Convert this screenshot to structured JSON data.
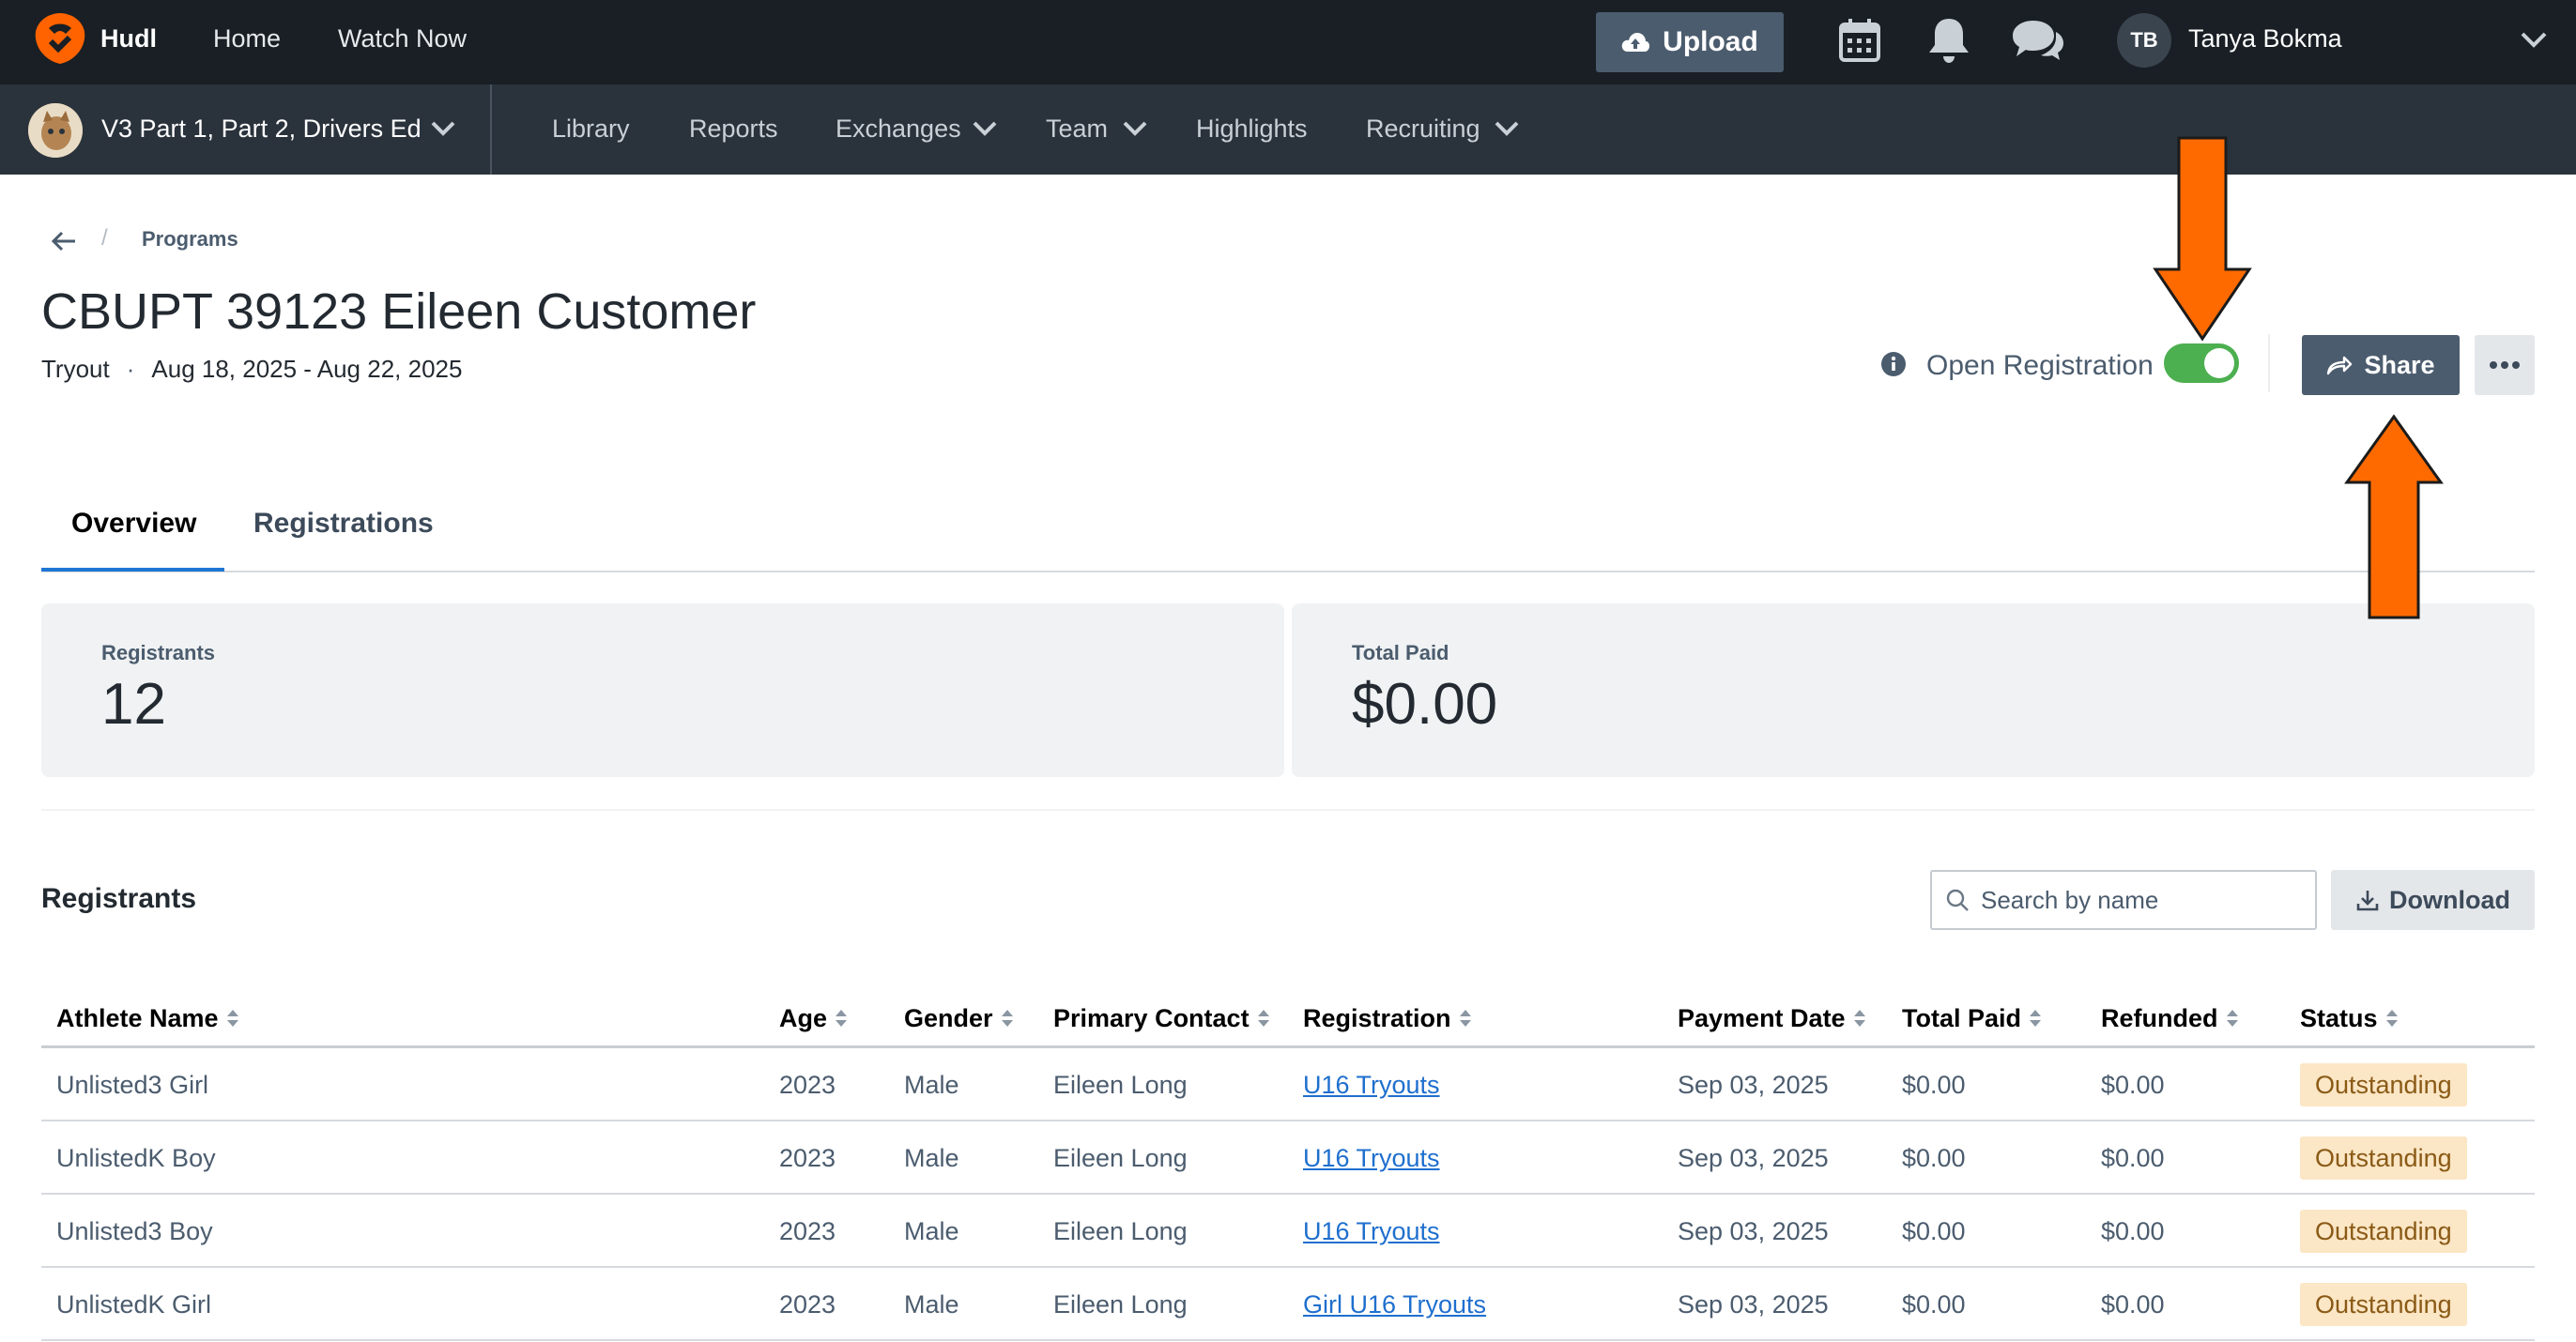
{
  "topbar": {
    "brand": "Hudl",
    "nav": [
      "Home",
      "Watch Now"
    ],
    "upload_label": "Upload",
    "icons": [
      "calendar-icon",
      "bell-icon",
      "chat-icon"
    ],
    "user_initials": "TB",
    "user_name": "Tanya Bokma"
  },
  "subbar": {
    "team_name": "V3 Part 1, Part 2, Drivers Ed",
    "nav": [
      "Library",
      "Reports",
      "Exchanges",
      "Team",
      "Highlights",
      "Recruiting"
    ]
  },
  "breadcrumb": {
    "current": "Programs",
    "separator": "/"
  },
  "program": {
    "title": "CBUPT 39123 Eileen Customer",
    "type": "Tryout",
    "separator": "·",
    "dates": "Aug 18, 2025 - Aug 22, 2025",
    "open_registration_label": "Open Registration",
    "open_registration_on": true,
    "share_label": "Share"
  },
  "tabs": [
    {
      "label": "Overview",
      "active": true
    },
    {
      "label": "Registrations",
      "active": false
    }
  ],
  "stats": {
    "registrants_label": "Registrants",
    "registrants_value": "12",
    "total_paid_label": "Total Paid",
    "total_paid_value": "$0.00"
  },
  "registrants": {
    "heading": "Registrants",
    "search_placeholder": "Search by name",
    "download_label": "Download",
    "columns": [
      "Athlete Name",
      "Age",
      "Gender",
      "Primary Contact",
      "Registration",
      "Payment Date",
      "Total Paid",
      "Refunded",
      "Status"
    ],
    "rows": [
      [
        "Unlisted3 Girl",
        "2023",
        "Male",
        "Eileen Long",
        "U16 Tryouts",
        "Sep 03, 2025",
        "$0.00",
        "$0.00",
        "Outstanding"
      ],
      [
        "UnlistedK Boy",
        "2023",
        "Male",
        "Eileen Long",
        "U16 Tryouts",
        "Sep 03, 2025",
        "$0.00",
        "$0.00",
        "Outstanding"
      ],
      [
        "Unlisted3 Boy",
        "2023",
        "Male",
        "Eileen Long",
        "U16 Tryouts",
        "Sep 03, 2025",
        "$0.00",
        "$0.00",
        "Outstanding"
      ],
      [
        "UnlistedK Girl",
        "2023",
        "Male",
        "Eileen Long",
        "Girl U16 Tryouts",
        "Sep 03, 2025",
        "$0.00",
        "$0.00",
        "Outstanding"
      ]
    ]
  },
  "colors": {
    "topbar_bg": "#191f24",
    "subbar_bg": "#2a333c",
    "brand_orange": "#ff6300",
    "toggle_on": "#4caf50",
    "link": "#1f6fce",
    "tab_active": "#1f76d3",
    "status_outstanding_bg": "#fbe6c5",
    "annotation_arrow": "#ff6a00"
  }
}
